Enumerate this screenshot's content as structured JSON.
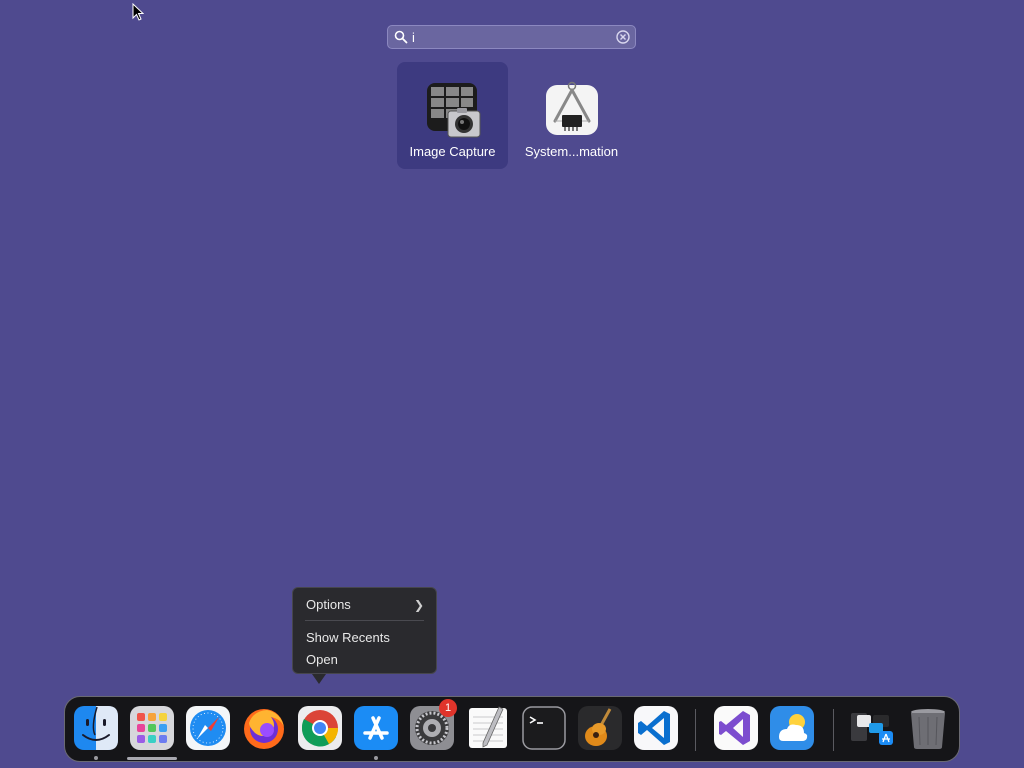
{
  "search": {
    "value": "i",
    "placeholder": ""
  },
  "results": [
    {
      "label": "Image Capture",
      "selected": true,
      "icon": "image-capture-icon"
    },
    {
      "label": "System...mation",
      "selected": false,
      "icon": "system-information-icon"
    }
  ],
  "context_menu": {
    "items": [
      {
        "label": "Options",
        "submenu": true
      },
      {
        "label": "Show Recents"
      },
      {
        "label": "Open"
      }
    ]
  },
  "dock": {
    "apps": [
      {
        "name": "Finder",
        "icon": "finder-icon",
        "running": true
      },
      {
        "name": "Launchpad",
        "icon": "launchpad-icon",
        "running": true
      },
      {
        "name": "Safari",
        "icon": "safari-icon"
      },
      {
        "name": "Firefox",
        "icon": "firefox-icon"
      },
      {
        "name": "Google Chrome",
        "icon": "chrome-icon"
      },
      {
        "name": "App Store",
        "icon": "app-store-icon",
        "running": true
      },
      {
        "name": "System Settings",
        "icon": "settings-icon",
        "badge": "1"
      },
      {
        "name": "TextEdit",
        "icon": "textedit-icon"
      },
      {
        "name": "Terminal",
        "icon": "terminal-icon"
      },
      {
        "name": "GarageBand",
        "icon": "garageband-icon"
      },
      {
        "name": "Visual Studio Code",
        "icon": "vscode-icon"
      },
      {
        "name": "Visual Studio",
        "icon": "visual-studio-icon"
      },
      {
        "name": "Weather",
        "icon": "weather-icon"
      },
      {
        "name": "Applications Stack",
        "icon": "stack-icon"
      },
      {
        "name": "Trash",
        "icon": "trash-icon"
      }
    ]
  },
  "colors": {
    "desktop": "#4f4a8f",
    "selected_tile": "#3d3a80",
    "badge": "#e0342b"
  }
}
